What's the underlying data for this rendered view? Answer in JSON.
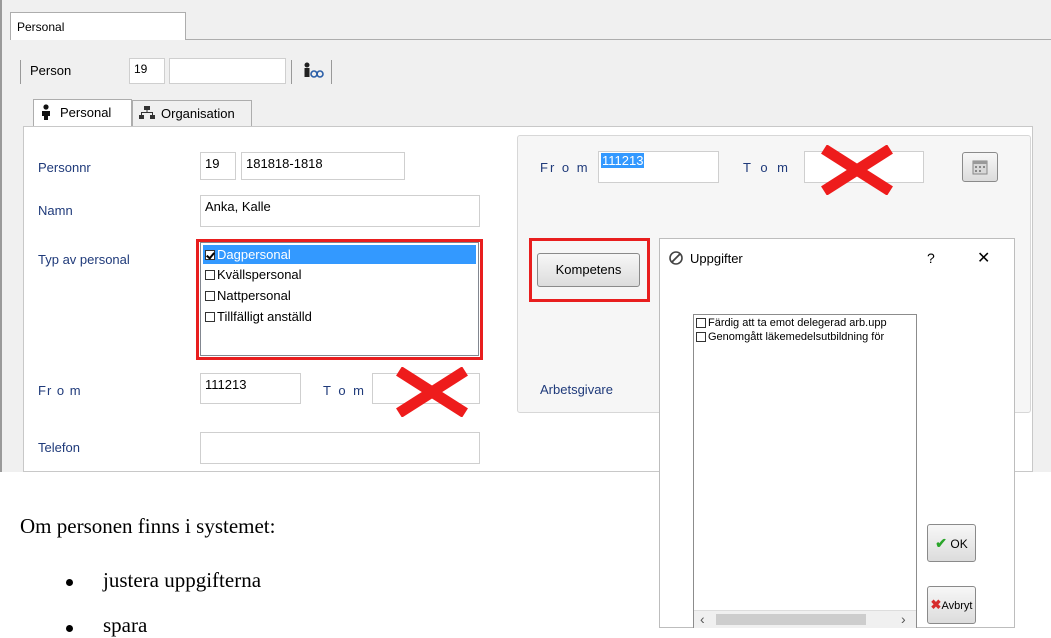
{
  "window": {
    "doc_tab": "Personal",
    "toolbar": {
      "person_label": "Person",
      "person_id": "19",
      "search_value": ""
    }
  },
  "tabs": [
    {
      "label": "Personal"
    },
    {
      "label": "Organisation"
    }
  ],
  "form": {
    "personnr_label": "Personnr",
    "personnr_id": "19",
    "personnr_value": "181818-1818",
    "namn_label": "Namn",
    "namn_value": "Anka, Kalle",
    "typ_label": "Typ av personal",
    "typ_options": [
      {
        "label": "Dagpersonal",
        "checked": true,
        "selected": true
      },
      {
        "label": "Kvällspersonal",
        "checked": false
      },
      {
        "label": "Nattpersonal",
        "checked": false
      },
      {
        "label": "Tillfälligt anställd",
        "checked": false
      }
    ],
    "from_label": "Fr o m",
    "from_value": "111213",
    "tom_label": "T o m",
    "tom_value": "",
    "telefon_label": "Telefon",
    "telefon_value": ""
  },
  "group": {
    "from_label": "Fr o m",
    "from_value": "111213",
    "tom_label": "T o m",
    "tom_value": "",
    "kompetens_button": "Kompetens",
    "arbetsgivare_label": "Arbetsgivare"
  },
  "dialog": {
    "title": "Uppgifter",
    "help": "?",
    "close": "✕",
    "items": [
      {
        "label": "Färdig att ta emot delegerad arb.upp",
        "checked": false
      },
      {
        "label": "Genomgått läkemedelsutbildning för",
        "checked": false
      }
    ],
    "ok_label": "OK",
    "cancel_label": "Avbryt",
    "scroll_left": "‹",
    "scroll_right": "›"
  },
  "document": {
    "intro": "Om personen finns i systemet:",
    "bullets": [
      "justera uppgifterna",
      "spara"
    ]
  },
  "colors": {
    "accent": "#3399ff",
    "highlight_red": "#e81e1e",
    "label_blue": "#1f3a7a"
  }
}
